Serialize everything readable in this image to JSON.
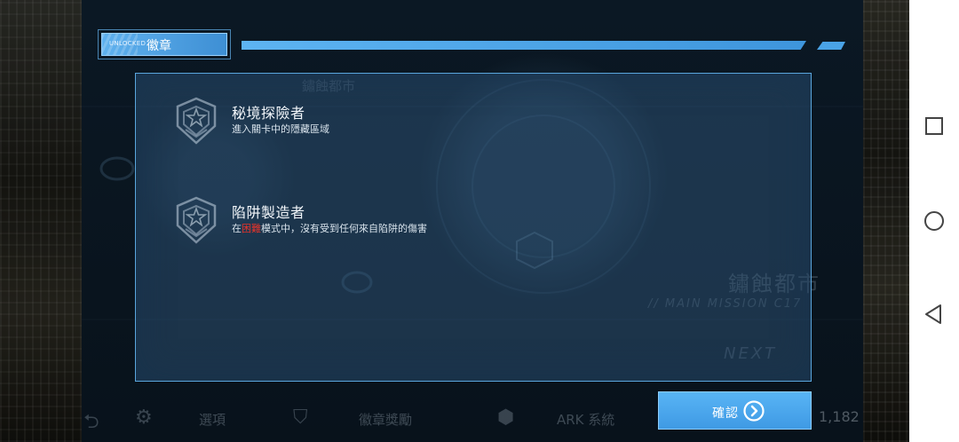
{
  "header": {
    "unlocked_tag": "UNLOCKED",
    "title": "徽章"
  },
  "background": {
    "top_label": "鏽蝕都市",
    "city_name": "鏽蝕都市",
    "mission": "// MAIN MISSION C17",
    "next": "NEXT"
  },
  "badges": [
    {
      "icon": "star-shield-icon",
      "name": "秘境探險者",
      "desc_before": "進入關卡中的隱藏區域",
      "desc_highlight": "",
      "desc_after": ""
    },
    {
      "icon": "star-shield-icon",
      "name": "陷阱製造者",
      "desc_before": "在",
      "desc_highlight": "困難",
      "desc_after": "模式中，沒有受到任何來自陷阱的傷害"
    }
  ],
  "confirm_button": {
    "label": "確認",
    "icon": "chevron-right-circle-icon"
  },
  "toolbar": {
    "options_label": "選項",
    "badges_label": "徽章獎勵",
    "ark_label": "ARK 系統",
    "count": "1,182"
  },
  "colors": {
    "accent": "#4aa3e6",
    "highlight_red": "#e8332a",
    "panel": "#36628a"
  },
  "navbar": {
    "icons": [
      "recent-apps-icon",
      "home-icon",
      "back-icon"
    ]
  }
}
